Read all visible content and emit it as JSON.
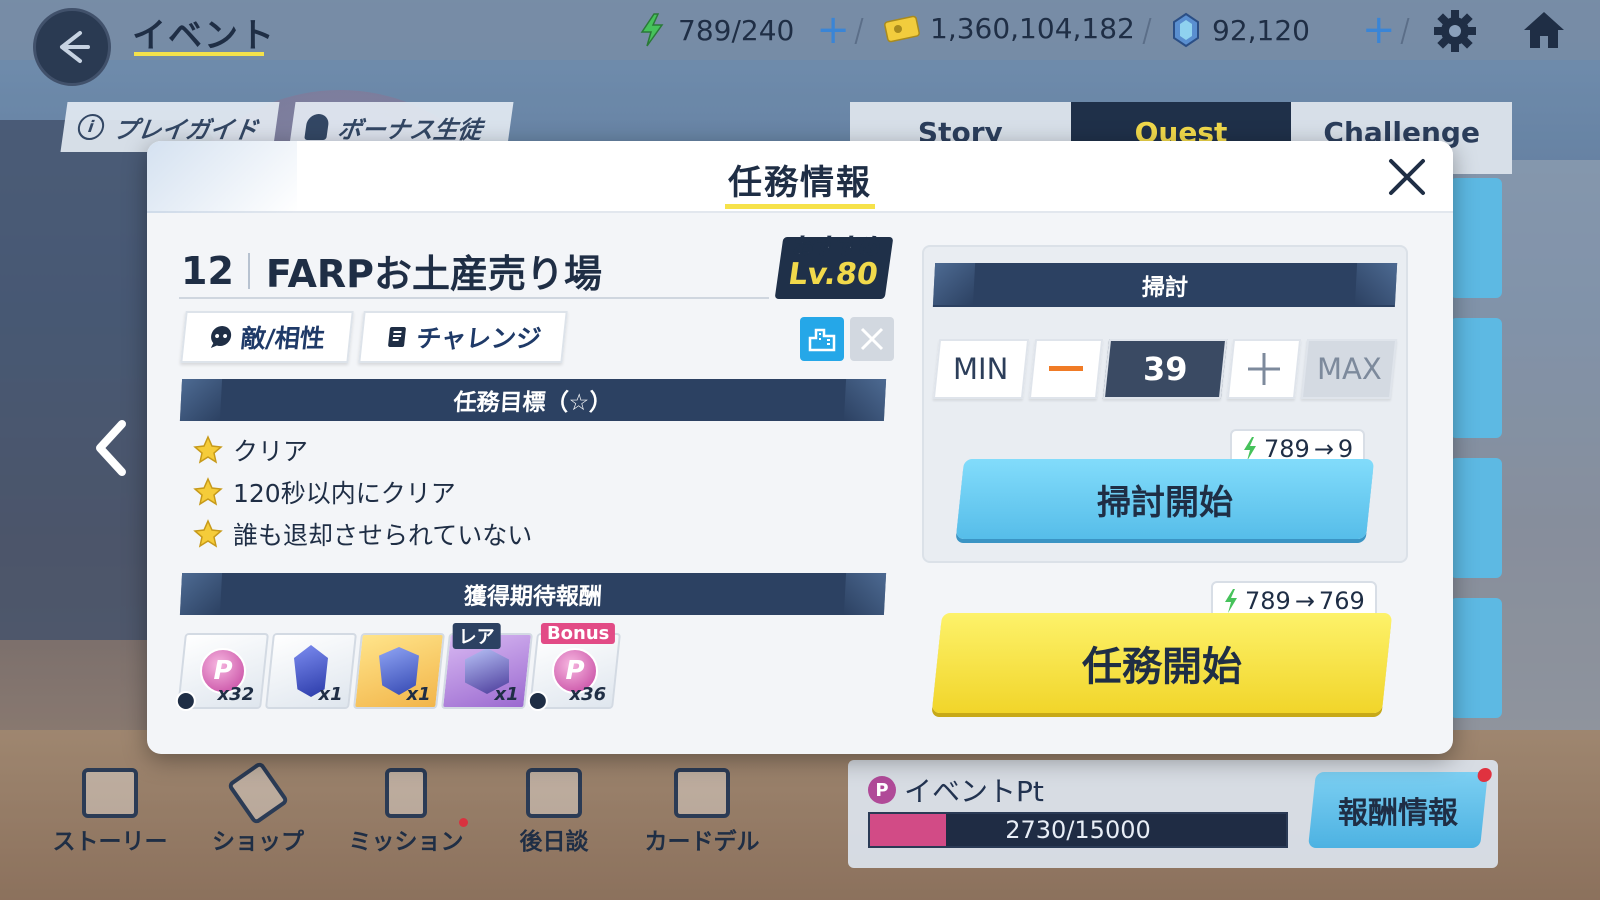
{
  "topbar": {
    "title": "イベント",
    "stamina": "789/240",
    "credits": "1,360,104,182",
    "gems": "92,120",
    "plus_icon": "plus-icon"
  },
  "guide_tabs": [
    "プレイガイド",
    "ボーナス生徒"
  ],
  "mode_tabs": [
    "Story",
    "Quest",
    "Challenge"
  ],
  "bottom_nav": [
    "ストーリー",
    "ショップ",
    "ミッション",
    "後日談",
    "カードデル"
  ],
  "event": {
    "label": "イベントPt",
    "progress_text": "2730/15000",
    "progress": 0.182,
    "reward_button": "報酬情報"
  },
  "modal": {
    "title": "任務情報",
    "quest_number": "12",
    "quest_name": "FARPお土産売り場",
    "recommend_label": "おすすめ",
    "recommend_level": "Lv.80",
    "tab_enemy": "敵/相性",
    "tab_challenge": "チャレンジ",
    "objectives_header": "任務目標（☆）",
    "objectives": [
      "クリア",
      "120秒以内にクリア",
      "誰も退却させられていない"
    ],
    "rewards_header": "獲得期待報酬",
    "rewards": [
      {
        "qty": "x32",
        "icon": "p-coin",
        "tag": ""
      },
      {
        "qty": "x1",
        "icon": "blue-crystal",
        "tag": ""
      },
      {
        "qty": "x1",
        "icon": "blue-shield",
        "tag": ""
      },
      {
        "qty": "x1",
        "icon": "purple-cube",
        "tag": "レア"
      },
      {
        "qty": "x36",
        "icon": "p-coin",
        "tag": "Bonus"
      }
    ],
    "sweep": {
      "header": "掃討",
      "min_label": "MIN",
      "value": "39",
      "max_label": "MAX",
      "cost_from": "789",
      "cost_to": "9",
      "start_label": "掃討開始"
    },
    "start": {
      "cost_from": "789",
      "cost_to": "769",
      "label": "任務開始"
    }
  },
  "colors": {
    "navy": "#1f3049",
    "accent_yellow": "#f1d94b",
    "sweep_blue": "#56bde9",
    "start_yellow": "#f1d52a",
    "minus_orange": "#f07b26"
  }
}
